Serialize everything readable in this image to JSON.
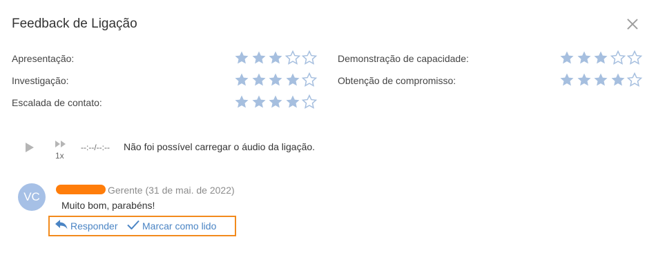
{
  "dialog": {
    "title": "Feedback de Ligação",
    "close_icon": "close-icon"
  },
  "ratings": [
    {
      "label": "Apresentação:",
      "stars": 3,
      "max": 5
    },
    {
      "label": "Investigação:",
      "stars": 4,
      "max": 5
    },
    {
      "label": "Escalada de contato:",
      "stars": 4,
      "max": 5
    },
    {
      "label": "Demonstração de capacidade:",
      "stars": 3,
      "max": 5
    },
    {
      "label": "Obtenção de compromisso:",
      "stars": 4,
      "max": 5
    }
  ],
  "player": {
    "speed": "1x",
    "time": "--:--/--:--",
    "message": "Não foi possível carregar o áudio da ligação."
  },
  "comment": {
    "avatar_initials": "VC",
    "author_meta": "Gerente (31 de mai. de 2022)",
    "text": "Muito bom, parabéns!",
    "reply_label": "Responder",
    "mark_read_label": "Marcar como lido"
  },
  "colors": {
    "star_filled": "#a6bfdf",
    "star_empty_stroke": "#a6bfdf",
    "link": "#4a84c4",
    "highlight": "#f28a1c",
    "redaction": "#ff7d0a",
    "avatar_bg": "#a6c0e6"
  }
}
